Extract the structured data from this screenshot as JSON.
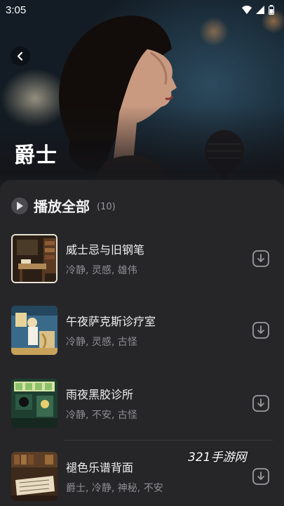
{
  "status": {
    "time": "3:05"
  },
  "header": {
    "title": "爵士"
  },
  "play_all": {
    "label": "播放全部",
    "count": "(10)"
  },
  "tracks": [
    {
      "title": "威士忌与旧钢笔",
      "tags": "冷静, 灵感, 雄伟"
    },
    {
      "title": "午夜萨克斯诊疗室",
      "tags": "冷静, 灵感, 古怪"
    },
    {
      "title": "雨夜黑胶诊所",
      "tags": "冷静, 不安, 古怪"
    },
    {
      "title": "褪色乐谱背面",
      "tags": "爵士, 冷静, 神秘, 不安"
    }
  ],
  "watermark": "321手游网",
  "icons": {
    "back": "chevron-left-icon",
    "play": "play-icon",
    "download": "download-icon",
    "wifi": "wifi-icon",
    "signal": "signal-icon",
    "battery": "battery-icon"
  }
}
